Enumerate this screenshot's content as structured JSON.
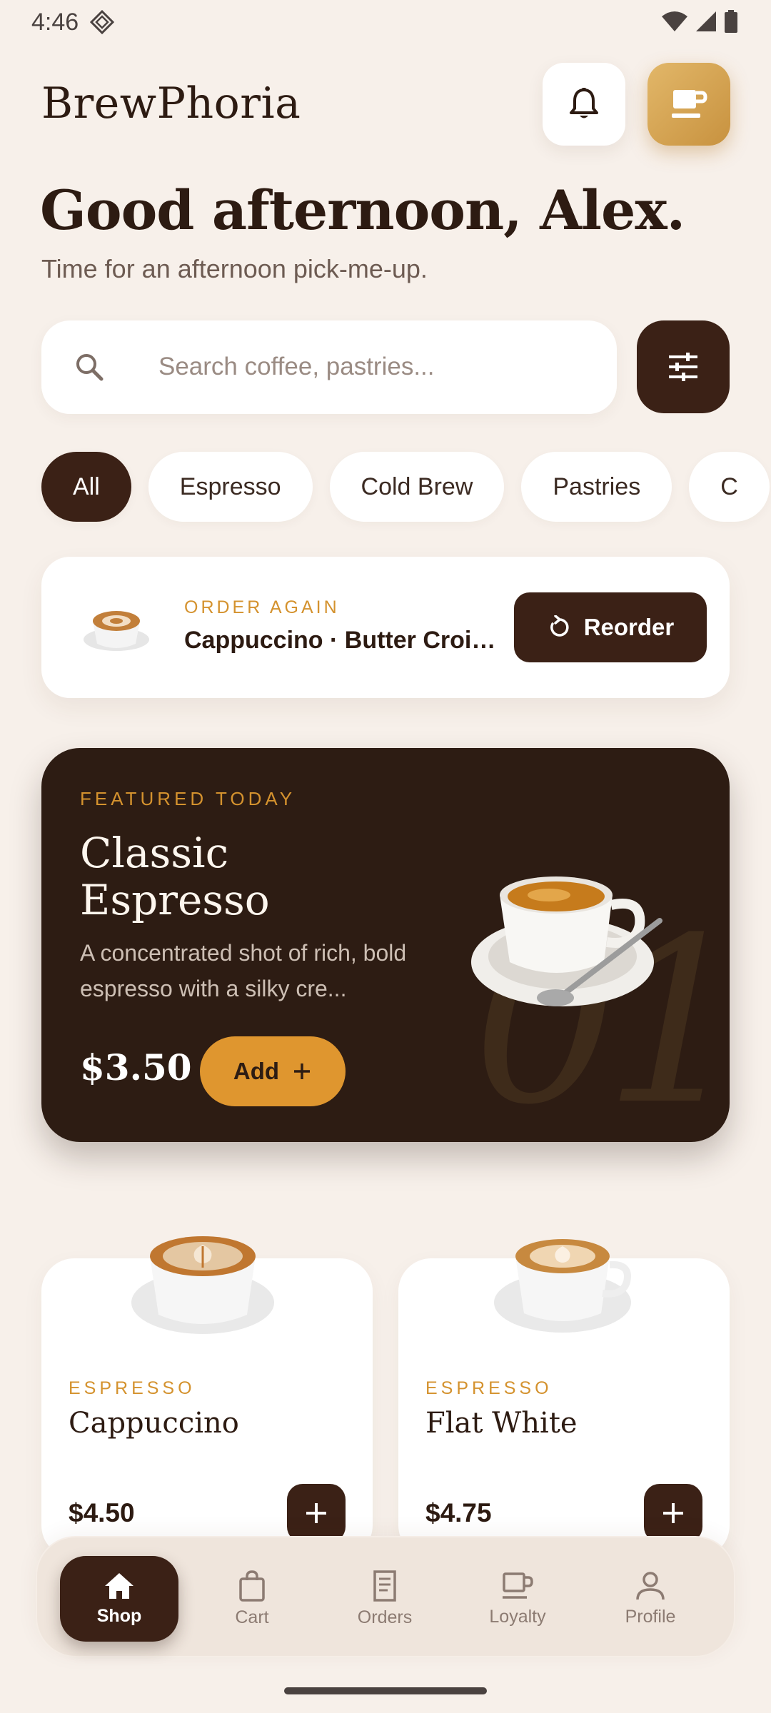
{
  "status": {
    "time": "4:46"
  },
  "header": {
    "brand": "BrewPhoria"
  },
  "greeting": {
    "title": "Good afternoon, Alex.",
    "subtitle": "Time for an afternoon pick-me-up."
  },
  "search": {
    "placeholder": "Search coffee, pastries..."
  },
  "chips": [
    {
      "label": "All",
      "active": true
    },
    {
      "label": "Espresso"
    },
    {
      "label": "Cold Brew"
    },
    {
      "label": "Pastries"
    },
    {
      "label": "C"
    }
  ],
  "order_again": {
    "label": "ORDER AGAIN",
    "items": "Cappuccino · Butter Croissant",
    "button": "Reorder"
  },
  "featured": {
    "label": "FEATURED TODAY",
    "title": "Classic Espresso",
    "description": "A concentrated shot of rich, bold espresso with a silky cre...",
    "price": "$3.50",
    "add_label": "Add",
    "number": "01"
  },
  "products": [
    {
      "category": "ESPRESSO",
      "name": "Cappuccino",
      "price": "$4.50"
    },
    {
      "category": "ESPRESSO",
      "name": "Flat White",
      "price": "$4.75"
    }
  ],
  "nav": [
    {
      "label": "Shop",
      "icon": "home-icon",
      "active": true
    },
    {
      "label": "Cart",
      "icon": "bag-icon"
    },
    {
      "label": "Orders",
      "icon": "receipt-icon"
    },
    {
      "label": "Loyalty",
      "icon": "cup-icon"
    },
    {
      "label": "Profile",
      "icon": "person-icon"
    }
  ],
  "colors": {
    "background": "#f7f0ea",
    "dark": "#3b2116",
    "accent": "#df962f",
    "gold": "#c8923f"
  }
}
